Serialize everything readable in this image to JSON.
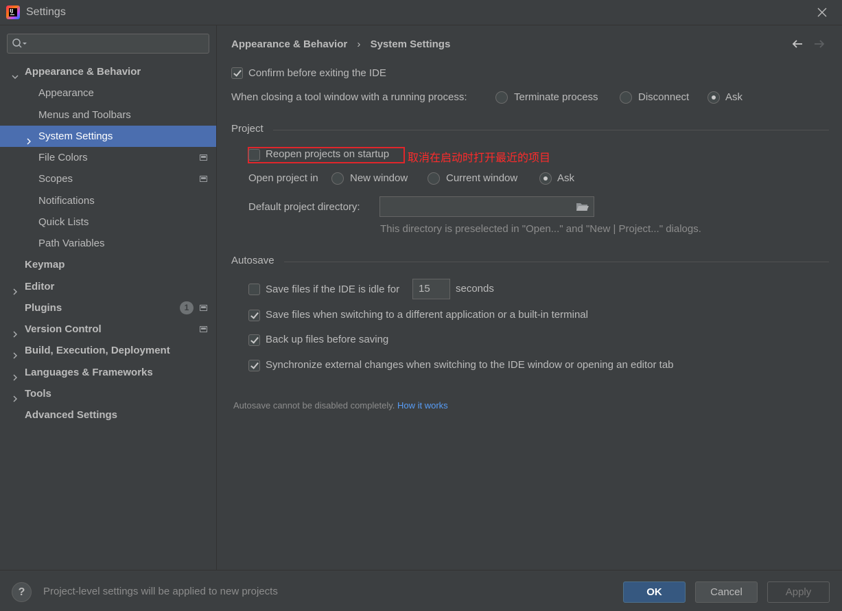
{
  "window": {
    "title": "Settings",
    "app_icon": "intellij-idea-icon"
  },
  "search": {
    "placeholder": "",
    "icon": "search-icon"
  },
  "sidebar": {
    "items": [
      {
        "label": "Appearance & Behavior",
        "expanded": true
      },
      {
        "label": "Appearance"
      },
      {
        "label": "Menus and Toolbars"
      },
      {
        "label": "System Settings",
        "selected": true
      },
      {
        "label": "File Colors"
      },
      {
        "label": "Scopes"
      },
      {
        "label": "Notifications"
      },
      {
        "label": "Quick Lists"
      },
      {
        "label": "Path Variables"
      },
      {
        "label": "Keymap"
      },
      {
        "label": "Editor"
      },
      {
        "label": "Plugins",
        "badge": "1"
      },
      {
        "label": "Version Control"
      },
      {
        "label": "Build, Execution, Deployment"
      },
      {
        "label": "Languages & Frameworks"
      },
      {
        "label": "Tools"
      },
      {
        "label": "Advanced Settings"
      }
    ]
  },
  "breadcrumb": {
    "parent": "Appearance & Behavior",
    "separator": "›",
    "current": "System Settings"
  },
  "general": {
    "confirm_exit": {
      "label": "Confirm before exiting the IDE",
      "checked": true
    },
    "closing_tool_window": {
      "label": "When closing a tool window with a running process:",
      "options": [
        "Terminate process",
        "Disconnect",
        "Ask"
      ],
      "selected": "Ask"
    }
  },
  "project": {
    "section_title": "Project",
    "reopen_projects": {
      "label": "Reopen projects on startup",
      "checked": false
    },
    "annotation": "取消在启动时打开最近的项目",
    "open_project_in": {
      "label": "Open project in",
      "options": [
        "New window",
        "Current window",
        "Ask"
      ],
      "selected": "Ask"
    },
    "default_directory": {
      "label": "Default project directory:",
      "value": "",
      "hint": "This directory is preselected in \"Open...\" and \"New | Project...\" dialogs."
    }
  },
  "autosave": {
    "section_title": "Autosave",
    "idle": {
      "label": "Save files if the IDE is idle for",
      "value": "15",
      "unit": "seconds",
      "checked": false
    },
    "switching_app": {
      "label": "Save files when switching to a different application or a built-in terminal",
      "checked": true
    },
    "backup": {
      "label": "Back up files before saving",
      "checked": true
    },
    "sync": {
      "label": "Synchronize external changes when switching to the IDE window or opening an editor tab",
      "checked": true
    },
    "note": "Autosave cannot be disabled completely.",
    "link": "How it works"
  },
  "footer": {
    "help": "?",
    "message": "Project-level settings will be applied to new projects",
    "ok": "OK",
    "cancel": "Cancel",
    "apply": "Apply"
  },
  "colors": {
    "selection": "#4b6eaf",
    "annotation": "#ff2b2b",
    "link": "#589df6",
    "primary_button": "#365880"
  }
}
